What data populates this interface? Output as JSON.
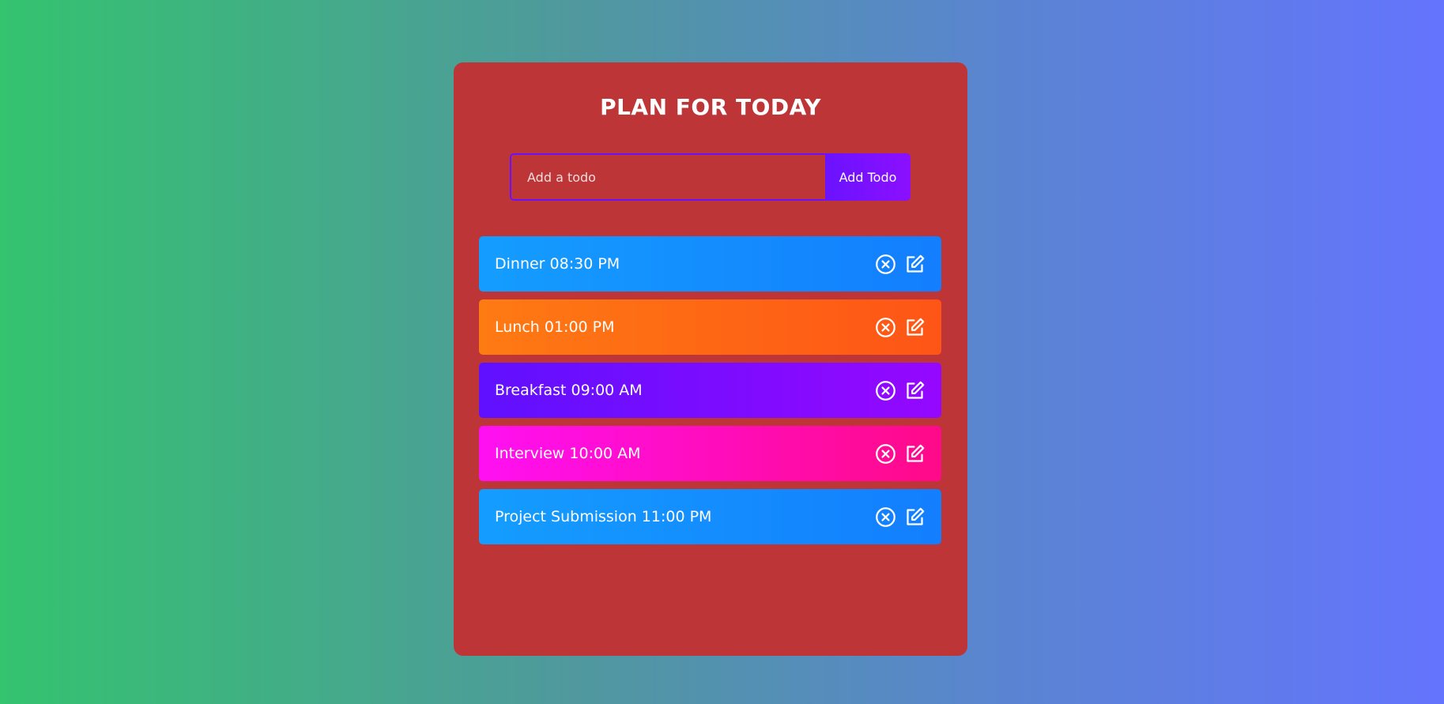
{
  "header": {
    "title": "PLAN FOR TODAY"
  },
  "form": {
    "placeholder": "Add a todo",
    "value": "",
    "add_label": "Add Todo"
  },
  "todos": [
    {
      "text": "Dinner 08:30 PM",
      "color": "#149dfe"
    },
    {
      "text": "Lunch 01:00 PM",
      "color": "#fe6a14"
    },
    {
      "text": "Breakfast 09:00 AM",
      "color": "#7a0cff"
    },
    {
      "text": "Interview 10:00 AM",
      "color": "#ff0bc0"
    },
    {
      "text": "Project Submission 11:00 PM",
      "color": "#149dfe"
    }
  ],
  "icons": {
    "delete": "close-circle-icon",
    "edit": "edit-icon"
  }
}
